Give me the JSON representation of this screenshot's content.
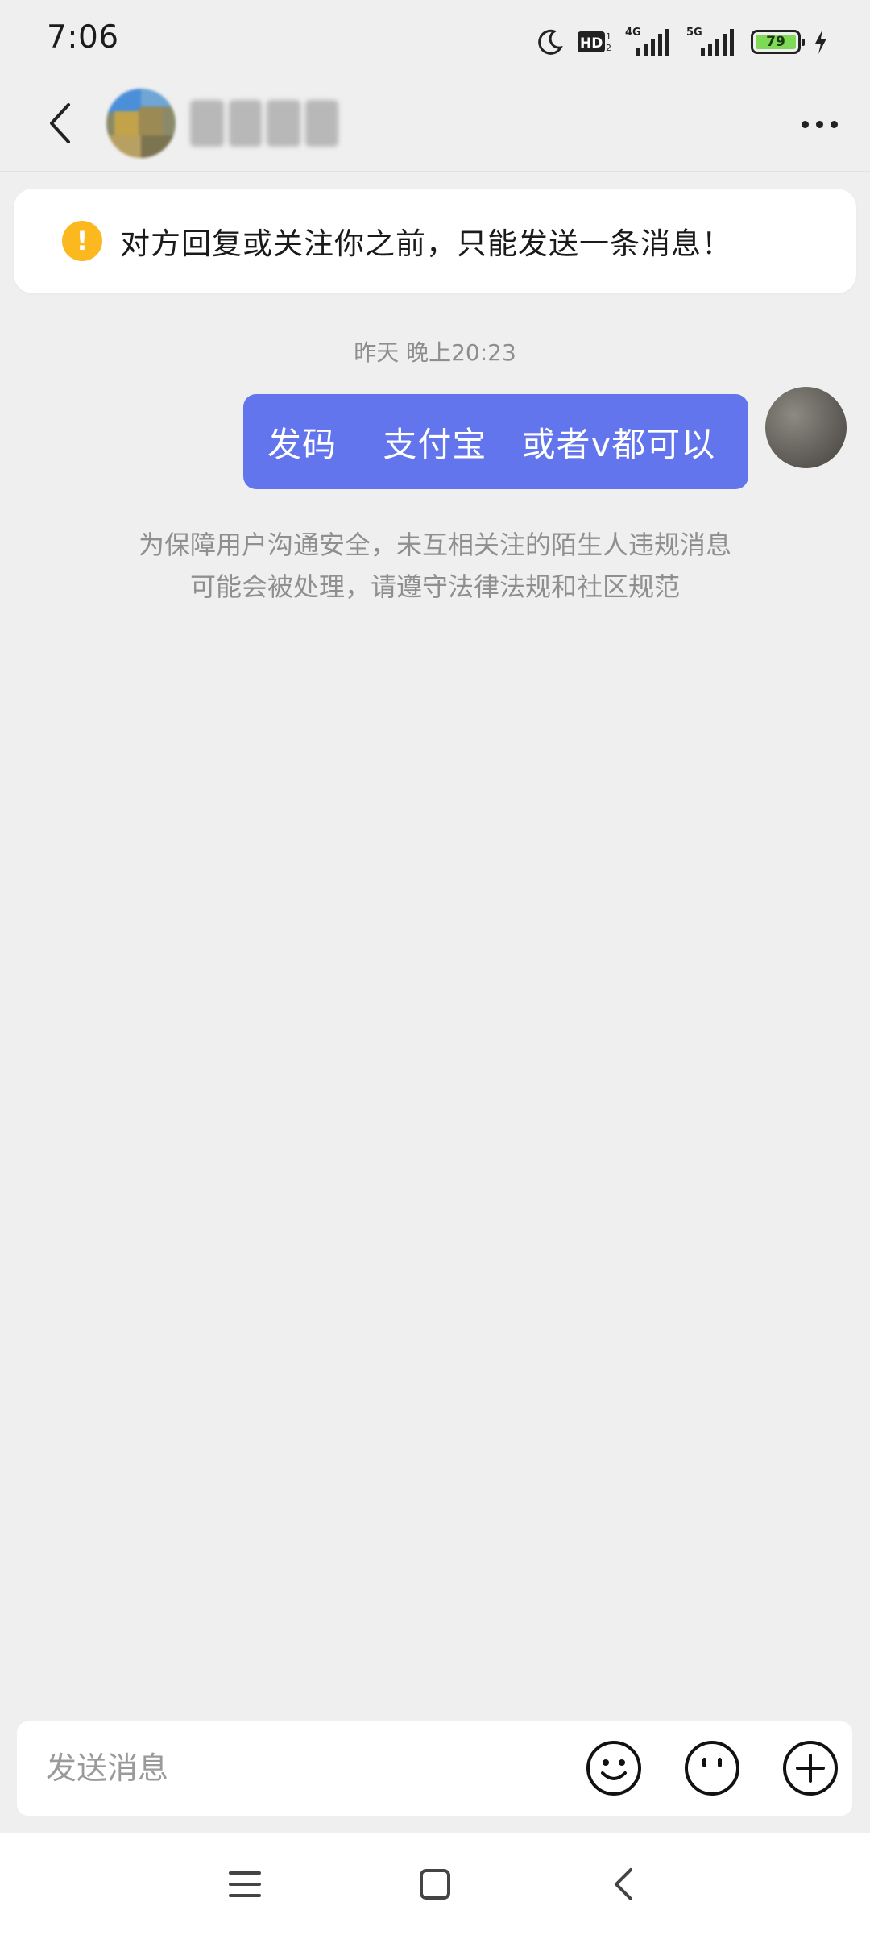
{
  "status_bar": {
    "time": "7:06",
    "network_hd": "HD",
    "network_4g": "4G",
    "network_5g": "5G",
    "battery_level": "79"
  },
  "header": {
    "back_icon": "chevron-left-icon",
    "more_icon": "more-horizontal-icon"
  },
  "notice": {
    "icon": "exclamation-icon",
    "text": "对方回复或关注你之前，只能发送一条消息！"
  },
  "chat": {
    "timestamp": "昨天 晚上20:23",
    "messages": [
      {
        "sender": "me",
        "text": "发码    支付宝   或者v都可以"
      }
    ],
    "system_tip_line1": "为保障用户沟通安全，未互相关注的陌生人违规消息",
    "system_tip_line2": "可能会被处理，请遵守法律法规和社区规范"
  },
  "input_bar": {
    "placeholder": "发送消息",
    "buttons": [
      "emoji-icon",
      "sticker-icon",
      "plus-icon"
    ]
  },
  "colors": {
    "accent_bubble": "#6375ec",
    "notice_icon": "#fbb81f",
    "background": "#efeff0"
  },
  "nav_bar": {
    "buttons": [
      "menu-icon",
      "home-icon",
      "back-icon"
    ]
  }
}
